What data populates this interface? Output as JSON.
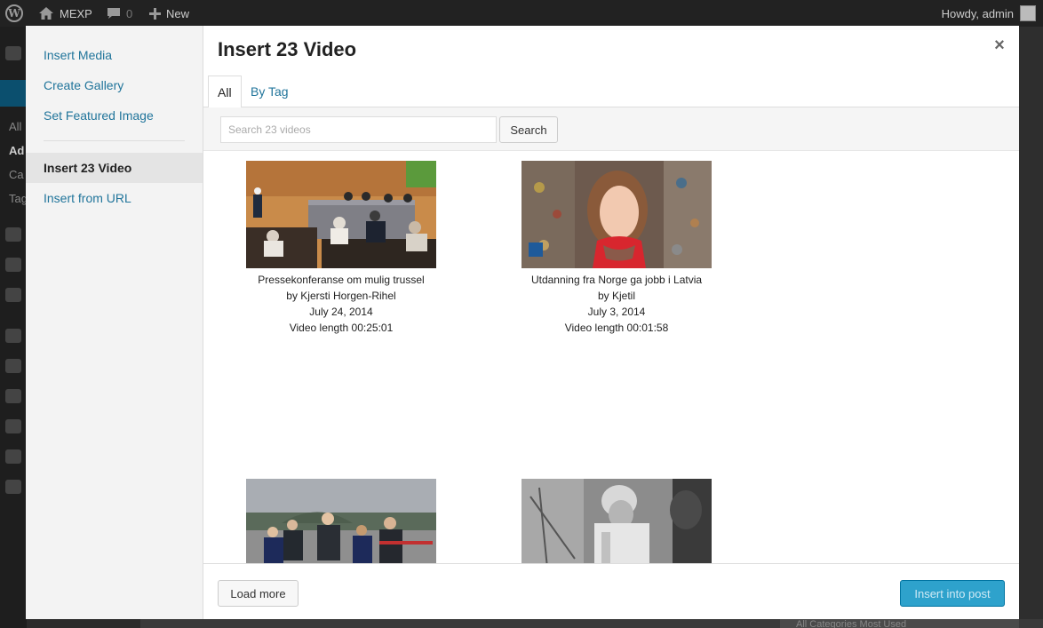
{
  "admin_bar": {
    "site_name": "MEXP",
    "comments_count": "0",
    "new_label": "New",
    "howdy": "Howdy, admin"
  },
  "background": {
    "submenu": [
      "All",
      "Ad",
      "Ca",
      "Tag"
    ],
    "bottom_text": "All Categories    Most Used"
  },
  "sidebar": {
    "items": [
      {
        "label": "Insert Media"
      },
      {
        "label": "Create Gallery"
      },
      {
        "label": "Set Featured Image"
      },
      {
        "label": "Insert 23 Video",
        "active": true
      },
      {
        "label": "Insert from URL"
      }
    ]
  },
  "main": {
    "title": "Insert 23 Video",
    "close_glyph": "×",
    "tabs": [
      {
        "label": "All",
        "active": true
      },
      {
        "label": "By Tag"
      }
    ],
    "search": {
      "placeholder": "Search 23 videos",
      "button": "Search"
    },
    "videos": [
      {
        "title": "Pressekonferanse om mulig trussel",
        "author": "by Kjersti Horgen-Rihel",
        "date": "July 24, 2014",
        "length": "Video length 00:25:01"
      },
      {
        "title": "Utdanning fra Norge ga jobb i Latvia",
        "author": "by Kjetil",
        "date": "July 3, 2014",
        "length": "Video length 00:01:58"
      },
      {
        "title": "",
        "author": "",
        "date": "",
        "length": ""
      },
      {
        "title": "",
        "author": "",
        "date": "",
        "length": ""
      }
    ],
    "footer": {
      "load_more": "Load more",
      "insert": "Insert into post"
    }
  },
  "colors": {
    "link": "#21759b",
    "primary_button": "#2ea2cc",
    "admin_bar": "#222222"
  }
}
